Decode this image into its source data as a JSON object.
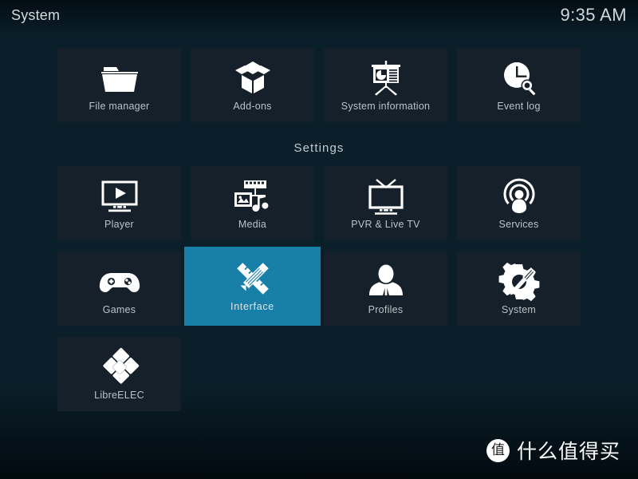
{
  "window": {
    "title": "System",
    "clock": "9:35 AM"
  },
  "theme": {
    "focus_color": "#1880a8",
    "tile_color": "#16202a",
    "label_color": "#b9c3c7",
    "background_top": "#04161e",
    "background_mid": "#0d4256"
  },
  "top_items": [
    {
      "label": "File manager",
      "icon": "folder-icon",
      "name": "tile-file-manager"
    },
    {
      "label": "Add-ons",
      "icon": "addon-box-icon",
      "name": "tile-add-ons"
    },
    {
      "label": "System information",
      "icon": "presentation-chart-icon",
      "name": "tile-system-information"
    },
    {
      "label": "Event log",
      "icon": "clock-search-icon",
      "name": "tile-event-log"
    }
  ],
  "settings": {
    "caption": "Settings",
    "items": [
      {
        "label": "Player",
        "icon": "monitor-play-icon",
        "name": "tile-player",
        "focused": false
      },
      {
        "label": "Media",
        "icon": "media-library-icon",
        "name": "tile-media",
        "focused": false
      },
      {
        "label": "PVR & Live TV",
        "icon": "television-icon",
        "name": "tile-pvr-live-tv",
        "focused": false
      },
      {
        "label": "Services",
        "icon": "broadcast-user-icon",
        "name": "tile-services",
        "focused": false
      },
      {
        "label": "Games",
        "icon": "gamepad-icon",
        "name": "tile-games",
        "focused": false
      },
      {
        "label": "Interface",
        "icon": "pencil-ruler-icon",
        "name": "tile-interface",
        "focused": true
      },
      {
        "label": "Profiles",
        "icon": "user-bust-icon",
        "name": "tile-profiles",
        "focused": false
      },
      {
        "label": "System",
        "icon": "gear-screwdriver-icon",
        "name": "tile-system",
        "focused": false
      },
      {
        "label": "LibreELEC",
        "icon": "libreelec-diamond-icon",
        "name": "tile-libreelec",
        "focused": false
      }
    ]
  },
  "watermark": {
    "badge": "值",
    "text": "什么值得买"
  }
}
